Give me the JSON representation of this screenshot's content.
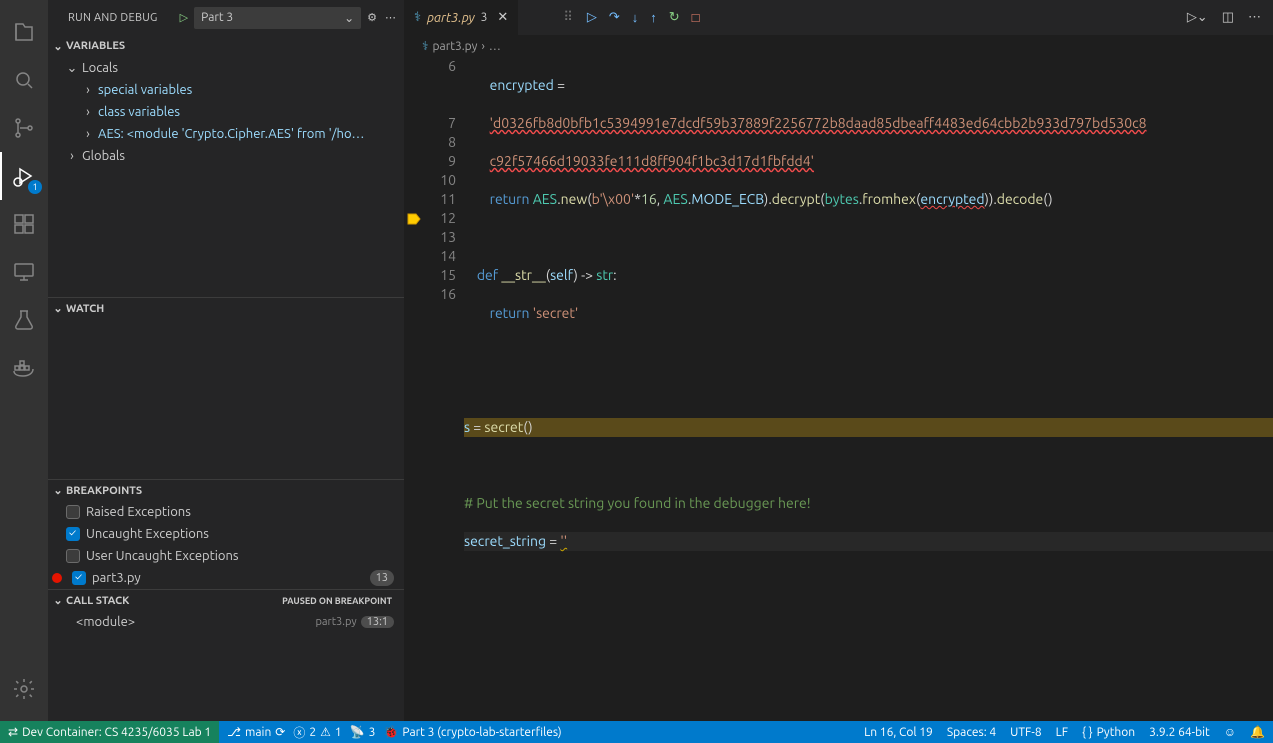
{
  "sidebar": {
    "title": "RUN AND DEBUG",
    "config": "Part 3",
    "variables": {
      "header": "VARIABLES",
      "locals": "Locals",
      "items": [
        "special variables",
        "class variables",
        "AES: <module 'Crypto.Cipher.AES' from '/ho…"
      ],
      "globals": "Globals"
    },
    "watch": {
      "header": "WATCH"
    },
    "breakpoints": {
      "header": "BREAKPOINTS",
      "items": [
        {
          "label": "Raised Exceptions",
          "checked": false
        },
        {
          "label": "Uncaught Exceptions",
          "checked": true
        },
        {
          "label": "User Uncaught Exceptions",
          "checked": false
        }
      ],
      "file": {
        "label": "part3.py",
        "count": "13"
      }
    },
    "callstack": {
      "header": "CALL STACK",
      "paused": "Paused on breakpoint",
      "frame": {
        "label": "<module>",
        "source": "part3.py",
        "pos": "13:1"
      }
    },
    "debug_badge": "1"
  },
  "tabs": {
    "file": "part3.py",
    "dirty_count": "3"
  },
  "breadcrumbs": {
    "file": "part3.py",
    "rest": "…"
  },
  "code": {
    "l6_a": "encrypted =",
    "l6_b": "'d0326fb8d0bfb1c5394991e7dcdf59b37889f2256772b8daad85dbeaff4483ed64cbb2b933d797bd530c8c92f57466d19033fe111d8ff904f1bc3d17d1fbfdd4'",
    "l7": "return AES.new(b'\\x00'*16, AES.MODE_ECB).decrypt(bytes.fromhex(encrypted)).decode()",
    "l9": "def __str__(self) -> str:",
    "l10": "return 'secret'",
    "l13": "s = secret()",
    "l15": "# Put the secret string you found in the debugger here!",
    "l16": "secret_string = ''"
  },
  "line_numbers": [
    "6",
    "7",
    "8",
    "9",
    "10",
    "11",
    "12",
    "13",
    "14",
    "15",
    "16"
  ],
  "status": {
    "remote": "Dev Container: CS 4235/6035 Lab 1",
    "branch": "main",
    "errors": "2",
    "warnings": "1",
    "radio": "3",
    "debug": "Part 3 (crypto-lab-starterfiles)",
    "lncol": "Ln 16, Col 19",
    "spaces": "Spaces: 4",
    "encoding": "UTF-8",
    "eol": "LF",
    "lang": "Python",
    "py": "3.9.2 64-bit"
  }
}
